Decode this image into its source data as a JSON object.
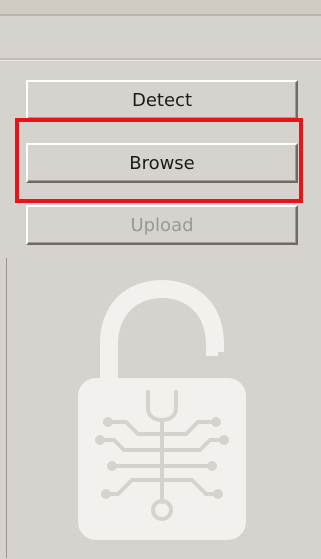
{
  "buttons": {
    "detect_label": "Detect",
    "browse_label": "Browse",
    "upload_label": "Upload"
  },
  "states": {
    "upload_enabled": false,
    "browse_highlighted": true
  },
  "colors": {
    "background": "#d6d3ce",
    "highlight": "#e8141a",
    "logo": "#f2f1ee",
    "disabled_text": "#9b9893"
  },
  "icons": {
    "logo": "unlocked-padlock-with-wrench-circuit-icon"
  }
}
